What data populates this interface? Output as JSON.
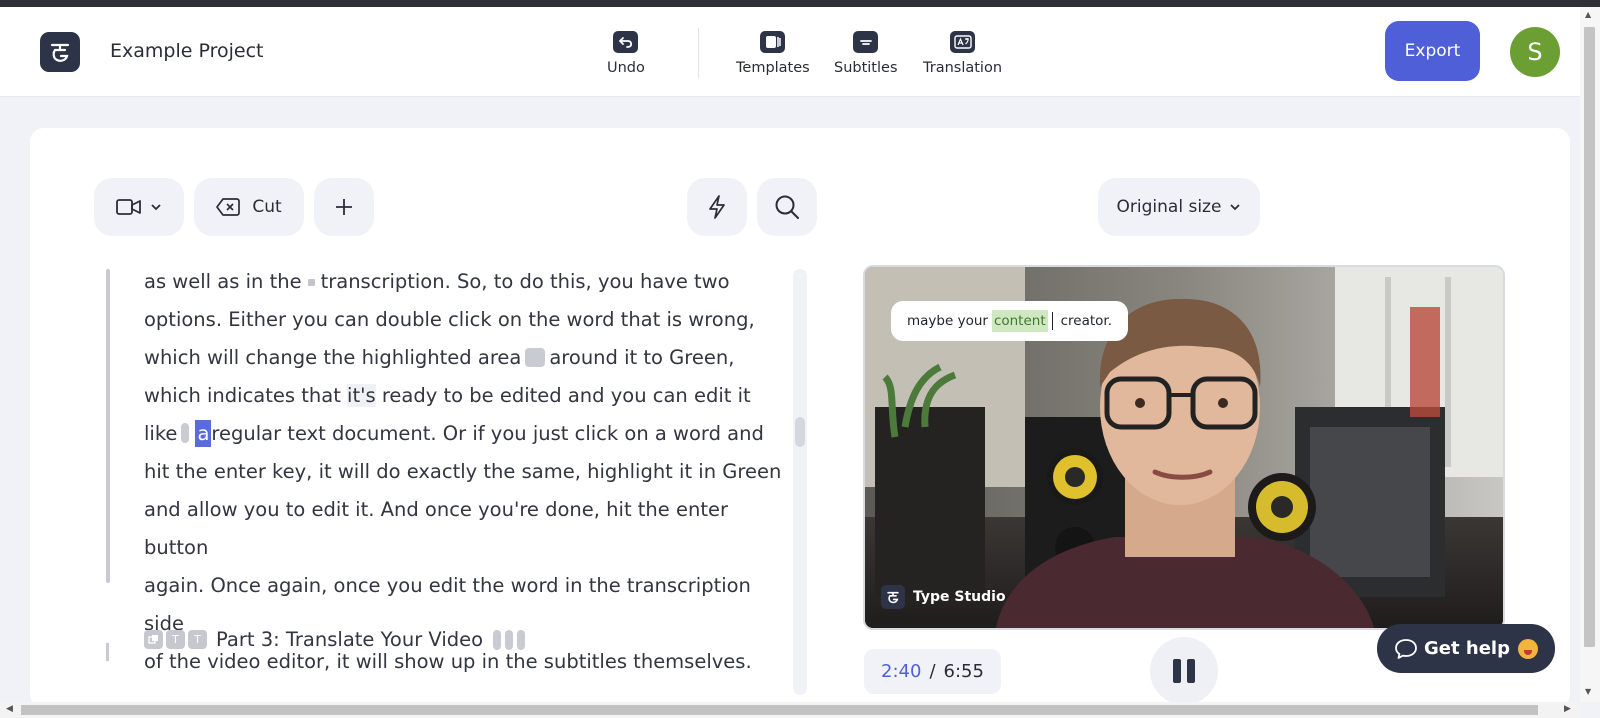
{
  "header": {
    "project_title": "Example Project",
    "tools": [
      {
        "label": "Undo",
        "icon": "undo-icon"
      },
      {
        "label": "Templates",
        "icon": "templates-icon"
      },
      {
        "label": "Subtitles",
        "icon": "subtitles-icon"
      },
      {
        "label": "Translation",
        "icon": "translation-icon"
      }
    ],
    "export_label": "Export",
    "avatar_initial": "S",
    "colors": {
      "accent": "#4e5fd8",
      "avatar": "#6b9e33",
      "dark": "#2e3448"
    }
  },
  "toolbar": {
    "cut_label": "Cut",
    "size_label": "Original size"
  },
  "transcript": {
    "l1a": "as well as in the",
    "l1b": "transcription. So, to do this, you have two",
    "l2": "options. Either you can double click on the word that is wrong,",
    "l3a": "which will change the highlighted area",
    "l3b": "around it to Green,",
    "l4a": "which indicates that ",
    "l4hl": "it's",
    "l4b": " ready to be edited and you can edit it",
    "l5a": "like",
    "l5sel": "a",
    "l5b": "regular text document. Or if you just click on a word and",
    "l6": "hit the enter key, it will do exactly the same, highlight it in Green",
    "l7": "and allow you to edit it. And once you're done, hit the enter button",
    "l8": "again. Once again, once you edit the word in the transcription side",
    "l9": "of the video editor, it will show up in the subtitles themselves.",
    "section_title": "Part 3: Translate Your Video",
    "section_glyphs": [
      "T",
      "T"
    ]
  },
  "video": {
    "caption_before": "maybe your",
    "caption_highlight": "content",
    "caption_after": "creator.",
    "watermark": "Type Studio"
  },
  "player": {
    "current_time": "2:40",
    "separator": "/",
    "total_time": "6:55"
  },
  "help": {
    "label": "Get help"
  }
}
